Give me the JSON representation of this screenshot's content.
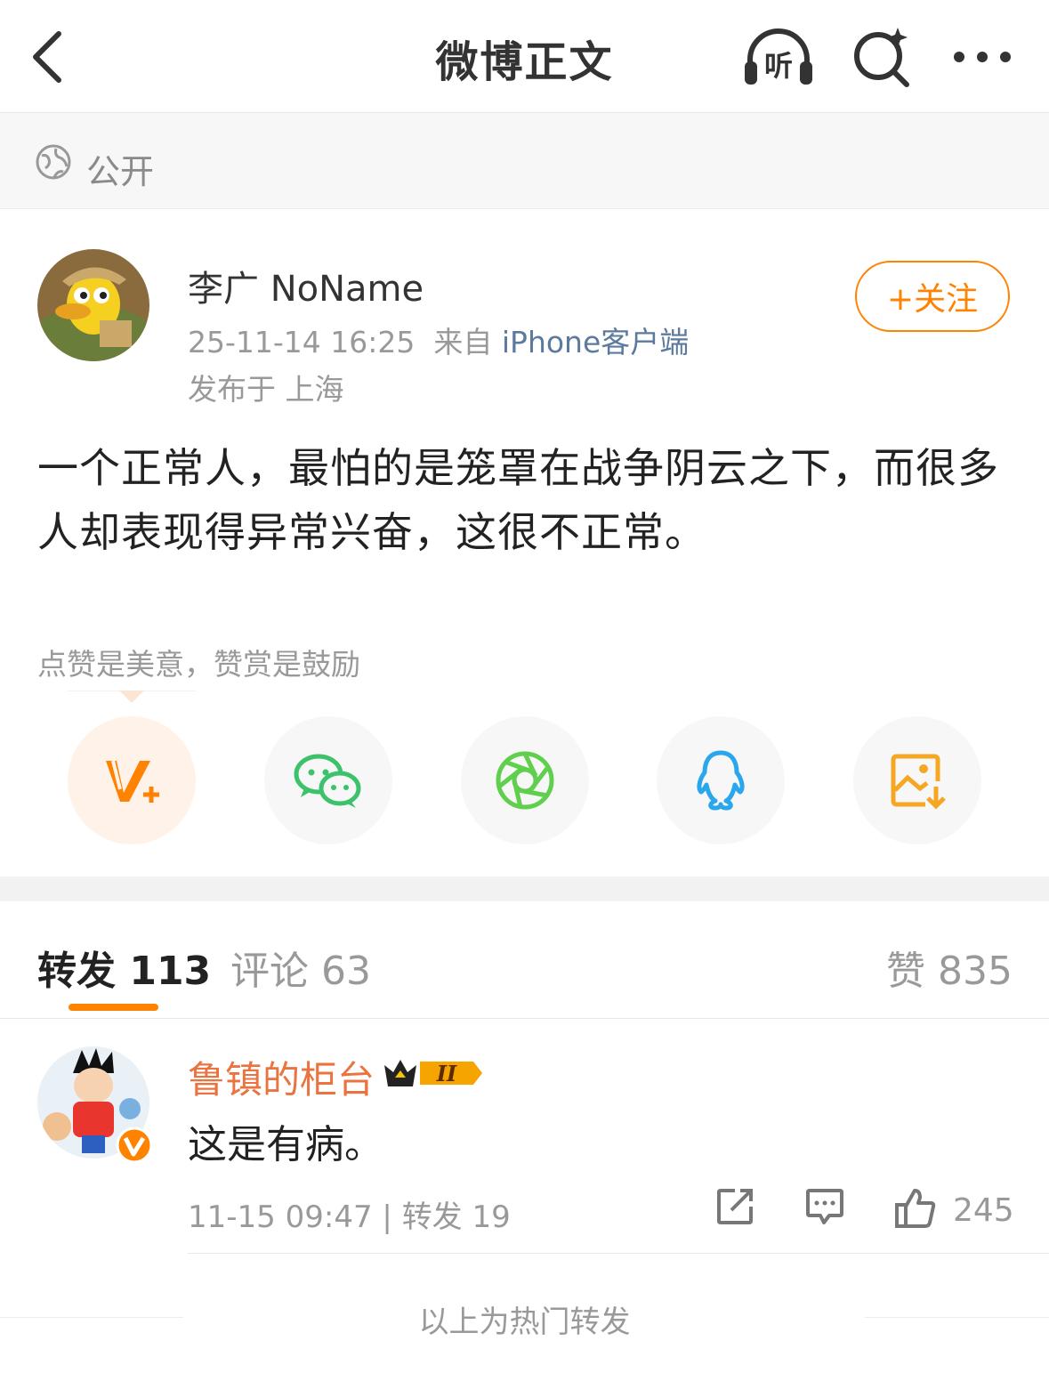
{
  "header": {
    "title": "微博正文",
    "listen_label": "听"
  },
  "visibility": {
    "label": "公开"
  },
  "post": {
    "author": "李广 NoName",
    "time": "25-11-14 16:25",
    "source_prefix": "来自",
    "source": "iPhone客户端",
    "location": "发布于 上海",
    "follow_label": "+关注",
    "content": "一个正常人，最怕的是笼罩在战争阴云之下，而很多人却表现得异常兴奋，这很不正常。"
  },
  "reward": {
    "hint": "点赞是美意，赞赏是鼓励"
  },
  "share_icons": [
    "vplus-icon",
    "wechat-icon",
    "moments-icon",
    "qq-icon",
    "save-image-icon"
  ],
  "tabs": {
    "repost": {
      "label": "转发",
      "count": "113"
    },
    "comment": {
      "label": "评论",
      "count": "63"
    },
    "like": {
      "label": "赞",
      "count": "835"
    }
  },
  "repost_item": {
    "user": "鲁镇的柜台",
    "badge": "II",
    "text": "这是有病。",
    "time": "11-15 09:47",
    "sep": "|",
    "repost_label": "转发 19",
    "like_count": "245"
  },
  "footer": {
    "text": "以上为热门转发"
  },
  "colors": {
    "accent": "#ff8200",
    "username": "#eb7340",
    "source_link": "#5b7a9e"
  }
}
